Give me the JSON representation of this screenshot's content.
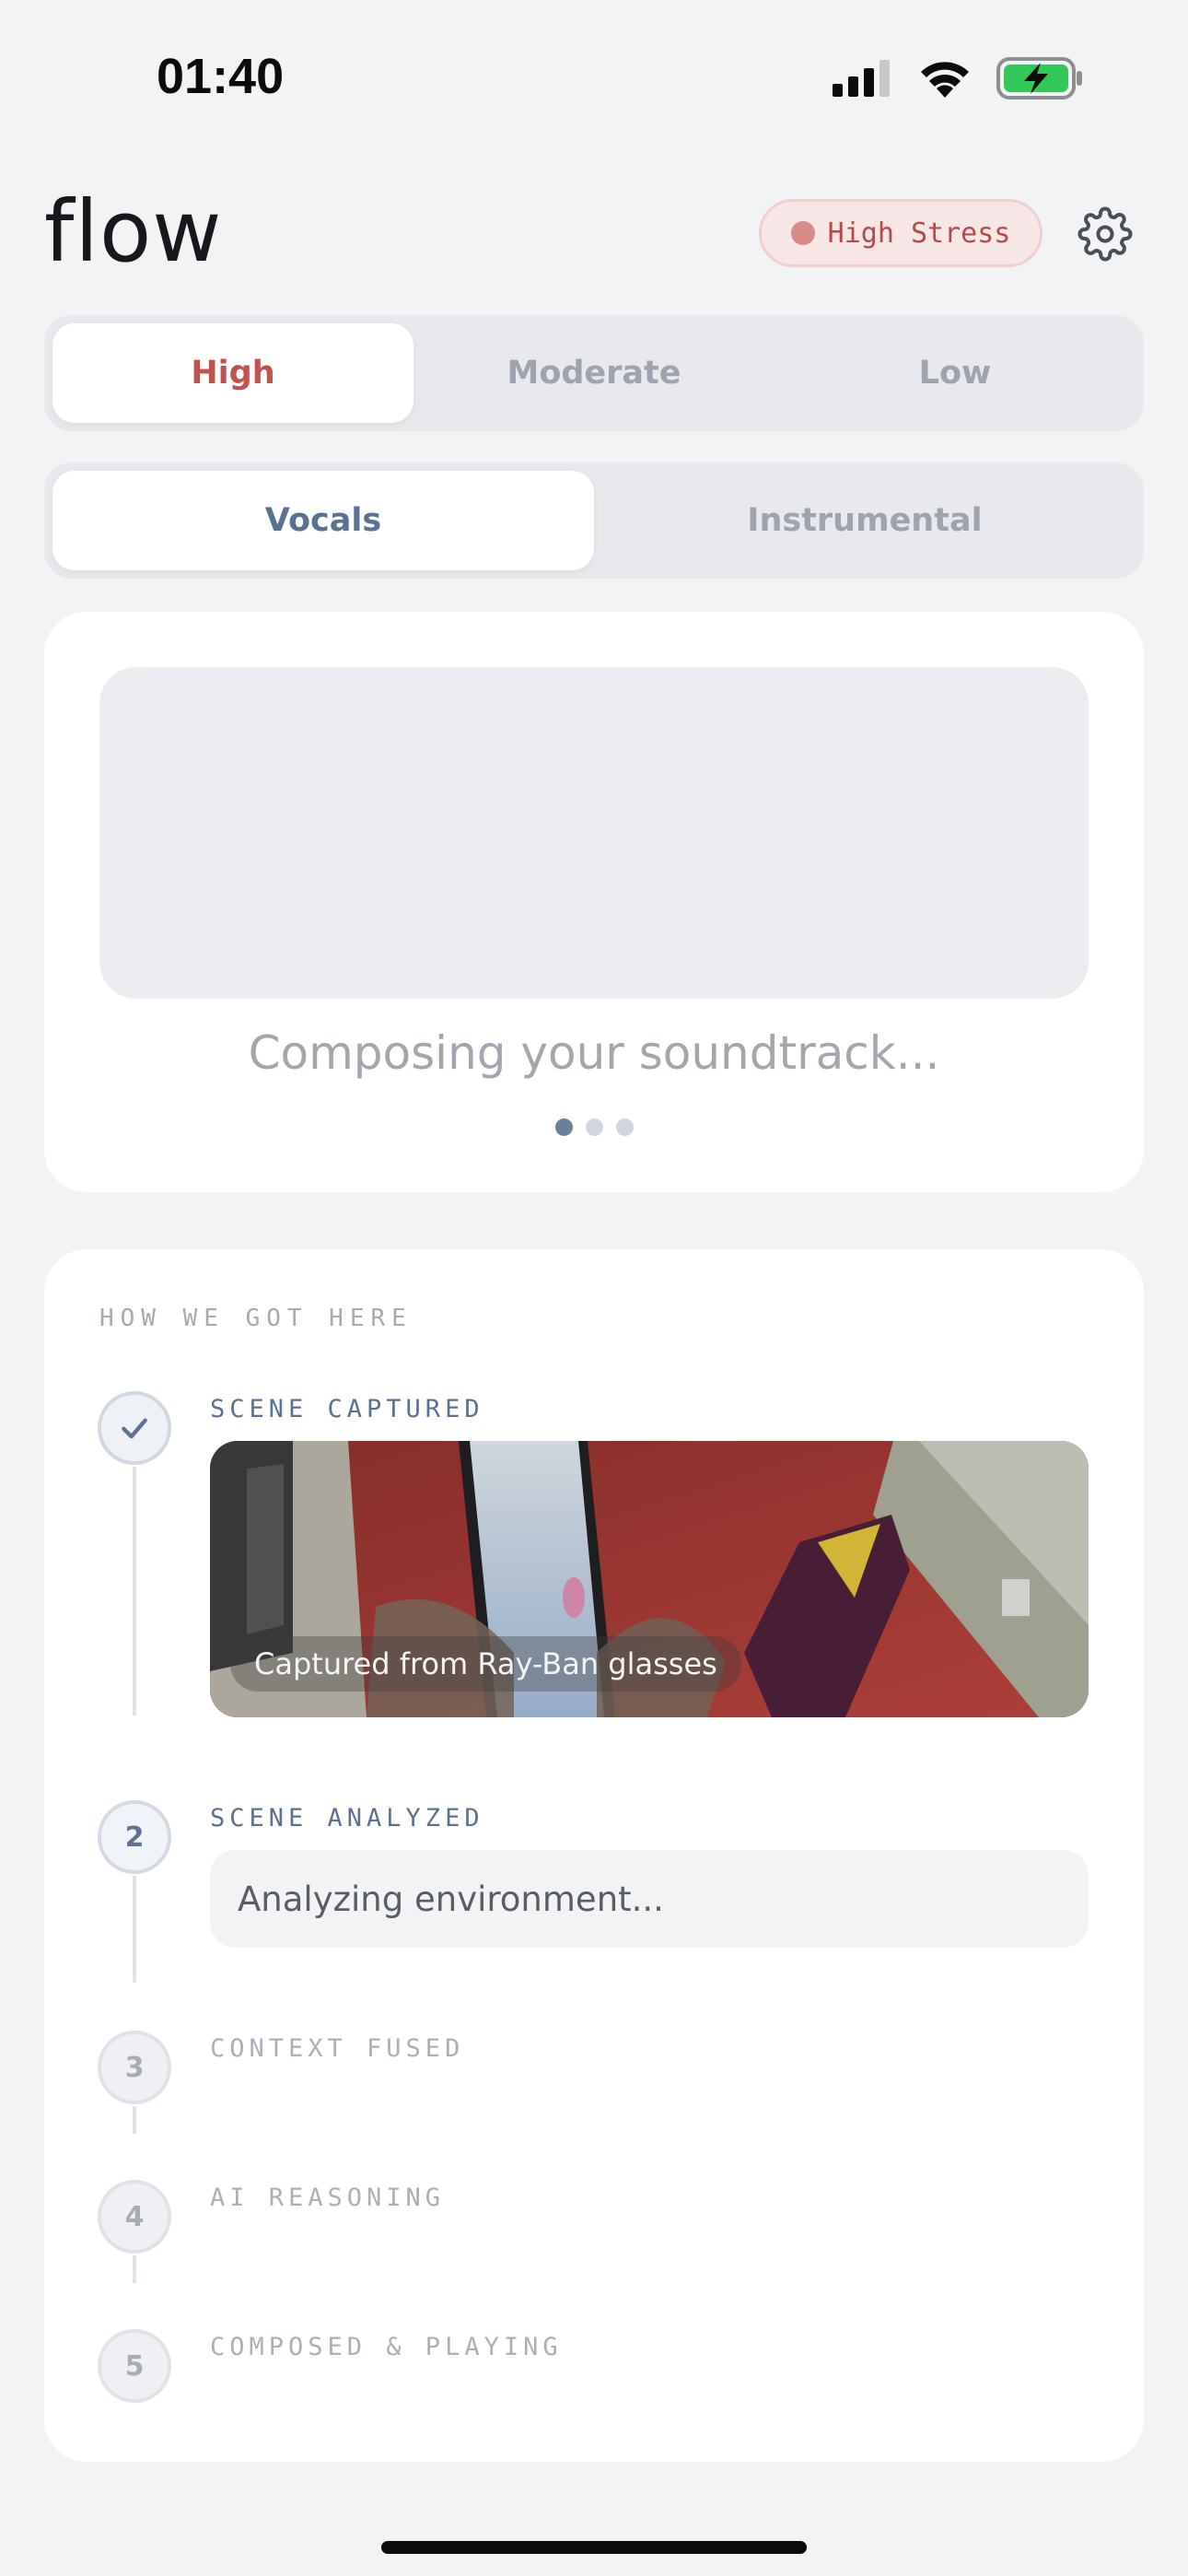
{
  "status_bar": {
    "time": "01:40",
    "icons": [
      "cellular-signal-icon",
      "wifi-icon",
      "battery-charging-icon"
    ]
  },
  "header": {
    "title": "flow",
    "stress_badge": "High Stress",
    "settings_icon": "gear-icon"
  },
  "stress_levels": {
    "options": [
      "High",
      "Moderate",
      "Low"
    ],
    "selected": "High"
  },
  "mode": {
    "options": [
      "Vocals",
      "Instrumental"
    ],
    "selected": "Vocals"
  },
  "player": {
    "status": "Composing your soundtrack...",
    "page_count": 3,
    "active_page": 1
  },
  "timeline": {
    "heading": "HOW WE GOT HERE",
    "steps": [
      {
        "marker": "✓",
        "title": "SCENE CAPTURED",
        "state": "done",
        "caption": "Captured from Ray-Ban glasses"
      },
      {
        "marker": "2",
        "title": "SCENE ANALYZED",
        "state": "current",
        "detail": "Analyzing environment..."
      },
      {
        "marker": "3",
        "title": "CONTEXT FUSED",
        "state": "pending"
      },
      {
        "marker": "4",
        "title": "AI REASONING",
        "state": "pending"
      },
      {
        "marker": "5",
        "title": "COMPOSED & PLAYING",
        "state": "pending"
      }
    ]
  },
  "colors": {
    "background": "#f2f3f5",
    "high_stress": "#c0524f",
    "accent": "#5a7190",
    "battery": "#34c759"
  }
}
